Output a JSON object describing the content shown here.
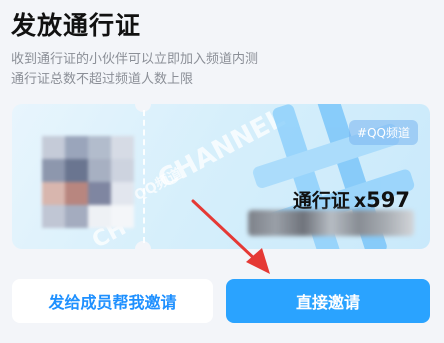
{
  "header": {
    "title": "发放通行证",
    "desc_line1": "收到通行证的小伙伴可以立即加入频道内测",
    "desc_line2": "通行证总数不超过频道人数上限"
  },
  "ticket": {
    "tag": "#QQ频道",
    "pass_label": "通行证",
    "pass_x": "x",
    "pass_count": "597",
    "watermark_1": "CHANNEL",
    "watermark_2": "QQ频道",
    "watermark_3": "CH"
  },
  "buttons": {
    "secondary_label": "发给成员帮我邀请",
    "primary_label": "直接邀请"
  },
  "colors": {
    "accent": "#2aa3ff",
    "secondary_text": "#1e90ff",
    "arrow": "#e53935"
  },
  "icons": {
    "annotation": "red-arrow-icon",
    "code": "blurred-qr-code",
    "art": "hash-symbol-art"
  }
}
